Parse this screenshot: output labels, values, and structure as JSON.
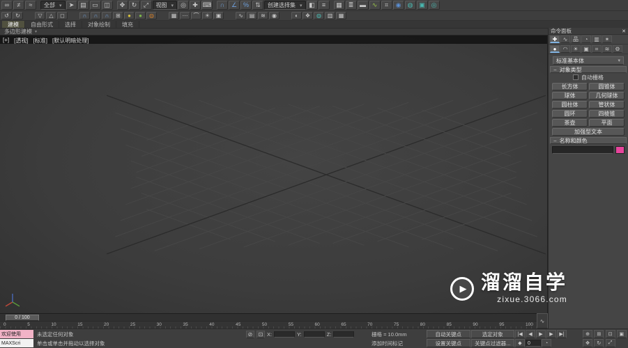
{
  "toolbar1": {
    "items": [
      {
        "name": "select-and-link-icon",
        "glyph": "∞"
      },
      {
        "name": "unlink-selection-icon",
        "glyph": "≠"
      },
      {
        "name": "bind-to-space-warp-icon",
        "glyph": "≈"
      },
      {
        "type": "sep",
        "name": "toolbar-separator",
        "interactable": false
      },
      {
        "type": "dropdown",
        "name": "selection-filter-dropdown",
        "label": "全部"
      },
      {
        "name": "select-object-icon",
        "glyph": "➤"
      },
      {
        "name": "select-by-name-icon",
        "glyph": "▤"
      },
      {
        "name": "rectangular-selection-icon",
        "glyph": "▭"
      },
      {
        "name": "window-crossing-icon",
        "glyph": "◫"
      },
      {
        "type": "sep",
        "name": "toolbar-separator",
        "interactable": false
      },
      {
        "name": "select-and-move-icon",
        "glyph": "✥"
      },
      {
        "name": "select-and-rotate-icon",
        "glyph": "↻"
      },
      {
        "name": "select-and-scale-icon",
        "glyph": "⤢"
      },
      {
        "type": "dropdown",
        "name": "reference-coordinate-dropdown",
        "label": "视图"
      },
      {
        "name": "use-pivot-center-icon",
        "glyph": "◎"
      },
      {
        "name": "select-and-manipulate-icon",
        "glyph": "✚"
      },
      {
        "name": "keyboard-override-icon",
        "glyph": "⌨"
      },
      {
        "type": "sep",
        "name": "toolbar-separator",
        "interactable": false
      },
      {
        "name": "snap-toggle-icon",
        "glyph": "∩",
        "color": "#6fa0dc"
      },
      {
        "name": "angle-snap-icon",
        "glyph": "∠",
        "color": "#6fa0dc"
      },
      {
        "name": "percent-snap-icon",
        "glyph": "%",
        "color": "#6fa0dc"
      },
      {
        "name": "spinner-snap-icon",
        "glyph": "⇅"
      },
      {
        "type": "dropdown",
        "name": "named-selection-sets-dropdown",
        "label": "创建选择集"
      },
      {
        "name": "mirror-icon",
        "glyph": "◧"
      },
      {
        "name": "align-icon",
        "glyph": "≡"
      },
      {
        "type": "sep",
        "name": "toolbar-separator",
        "interactable": false
      },
      {
        "name": "scene-explorer-icon",
        "glyph": "▦"
      },
      {
        "name": "layer-explorer-icon",
        "glyph": "≣"
      },
      {
        "name": "ribbon-toggle-icon",
        "glyph": "▬"
      },
      {
        "name": "curve-editor-icon",
        "glyph": "∿",
        "color": "#9ac54a"
      },
      {
        "name": "schematic-view-icon",
        "glyph": "⌗"
      },
      {
        "name": "material-editor-icon",
        "glyph": "◉",
        "color": "#5b8fd4"
      },
      {
        "name": "render-setup-icon",
        "glyph": "◍",
        "color": "#49b8b0"
      },
      {
        "name": "rendered-frame-icon",
        "glyph": "▣",
        "color": "#49b8b0"
      },
      {
        "name": "render-production-icon",
        "glyph": "◎",
        "color": "#49b8b0"
      }
    ]
  },
  "toolbar2": {
    "items": [
      {
        "name": "undo-icon",
        "glyph": "↺"
      },
      {
        "name": "redo-icon",
        "glyph": "↻"
      },
      {
        "type": "sep",
        "name": "toolbar-separator",
        "interactable": false
      },
      {
        "name": "select-child-icon",
        "glyph": "▽"
      },
      {
        "name": "select-parent-icon",
        "glyph": "△"
      },
      {
        "name": "selection-lock-icon",
        "glyph": "◻"
      },
      {
        "type": "sep",
        "name": "toolbar-separator",
        "interactable": false
      },
      {
        "name": "snap-2d-icon",
        "glyph": "∩",
        "color": "#6fa0dc"
      },
      {
        "name": "snap-25d-icon",
        "glyph": "∩",
        "color": "#6fa0dc"
      },
      {
        "name": "snap-3d-icon",
        "glyph": "∩",
        "color": "#6fa0dc"
      },
      {
        "name": "ortho-toggle-icon",
        "glyph": "⊞"
      },
      {
        "name": "isolate-selection-icon",
        "glyph": "●",
        "color": "#d8c23c"
      },
      {
        "name": "select-similar-icon",
        "glyph": "●",
        "color": "#7db84a"
      },
      {
        "name": "material-sample-icon",
        "glyph": "◍",
        "color": "#c87a2a"
      },
      {
        "type": "sep",
        "name": "toolbar-separator",
        "interactable": false
      },
      {
        "name": "array-icon",
        "glyph": "▦"
      },
      {
        "name": "spacing-tool-icon",
        "glyph": "⋯"
      },
      {
        "name": "measure-icon",
        "glyph": "⌒"
      },
      {
        "name": "light-toggle-icon",
        "glyph": "☀"
      },
      {
        "name": "camera-create-icon",
        "glyph": "▣"
      },
      {
        "type": "sep",
        "name": "toolbar-separator",
        "interactable": false
      },
      {
        "name": "track-view-icon",
        "glyph": "∿"
      },
      {
        "name": "dope-sheet-icon",
        "glyph": "▤"
      },
      {
        "name": "motion-mixer-icon",
        "glyph": "≋"
      },
      {
        "name": "grab-viewport-icon",
        "glyph": "◉"
      },
      {
        "type": "sep",
        "name": "toolbar-separator",
        "interactable": false
      },
      {
        "name": "environment-icon",
        "glyph": "◐"
      },
      {
        "name": "effects-icon",
        "glyph": "❖"
      },
      {
        "name": "render-last-icon",
        "glyph": "◍",
        "color": "#49b8b0"
      },
      {
        "name": "state-sets-icon",
        "glyph": "▥"
      },
      {
        "name": "batch-render-icon",
        "glyph": "▦"
      }
    ]
  },
  "ribbon": {
    "tabs": [
      {
        "label": "建模",
        "active": true
      },
      {
        "label": "自由形式"
      },
      {
        "label": "选择"
      },
      {
        "label": "对象绘制"
      },
      {
        "label": "填充"
      }
    ],
    "minimize_glyph": "▼",
    "panel_label": "多边形建模"
  },
  "viewport": {
    "labels": [
      {
        "name": "viewport-general-menu",
        "label": "[+]"
      },
      {
        "name": "viewport-pov-menu",
        "label": "[透视]"
      },
      {
        "name": "viewport-render-preset-menu",
        "label": "[标准]"
      },
      {
        "name": "viewport-shading-menu",
        "label": "[默认明暗处理]"
      }
    ]
  },
  "command_panel": {
    "title": "命令面板",
    "close_glyph": "✕",
    "collapse_glyph": "−",
    "dropdown_caret": "▾",
    "tabs": [
      {
        "name": "tab-create",
        "glyph": "✚",
        "active": true
      },
      {
        "name": "tab-modify",
        "glyph": "∿"
      },
      {
        "name": "tab-hierarchy",
        "glyph": "品"
      },
      {
        "name": "tab-motion",
        "glyph": "◔"
      },
      {
        "name": "tab-display",
        "glyph": "▥"
      },
      {
        "name": "tab-utilities",
        "glyph": "✶"
      }
    ],
    "subtabs": [
      {
        "name": "subtab-geometry",
        "glyph": "●",
        "active": true
      },
      {
        "name": "subtab-shapes",
        "glyph": "◠"
      },
      {
        "name": "subtab-lights",
        "glyph": "☀"
      },
      {
        "name": "subtab-cameras",
        "glyph": "▣"
      },
      {
        "name": "subtab-helpers",
        "glyph": "⌗"
      },
      {
        "name": "subtab-space-warps",
        "glyph": "≋"
      },
      {
        "name": "subtab-systems",
        "glyph": "⚙"
      }
    ],
    "category": "标准基本体",
    "rollouts": {
      "object_type": "对象类型",
      "name_color": "名称和颜色"
    },
    "autogrid_label": "自动栅格",
    "primitive_buttons": [
      "长方体",
      "圆锥体",
      "球体",
      "几何球体",
      "圆柱体",
      "管状体",
      "圆环",
      "四棱锥",
      "茶壶",
      "平面"
    ],
    "wide_button": "加强型文本",
    "name_value": "",
    "swatch_color": "#e8459c"
  },
  "timeline": {
    "handle_label": "0 / 100",
    "ticks": [
      "0",
      "5",
      "10",
      "15",
      "20",
      "25",
      "30",
      "35",
      "40",
      "45",
      "50",
      "55",
      "60",
      "65",
      "70",
      "75",
      "80",
      "85",
      "90",
      "95",
      "100"
    ],
    "mini_curve_glyph": "∿"
  },
  "status": {
    "macro_row": "欢迎使用",
    "listener_row": "MAXScri",
    "status_line": "未选定任何对象",
    "prompt_line": "单击或单击并拖动以选择对象",
    "isolate_glyph": "⊘",
    "lock_glyph": "⊡",
    "x_label": "X:",
    "y_label": "Y:",
    "z_label": "Z:",
    "grid_label": "栅格 = 10.0mm",
    "time_tag": "添加时间标记",
    "auto_key": "自动关键点",
    "selected": "选定对象",
    "set_key": "设置关键点",
    "key_filters": "关键点过滤器...",
    "frame_field": "0",
    "key_toggle_glyph": "◆",
    "time_config_glyph": "◔",
    "playback": [
      {
        "name": "go-to-start-button",
        "glyph": "|◀"
      },
      {
        "name": "previous-frame-button",
        "glyph": "◀"
      },
      {
        "name": "play-button",
        "glyph": "▶"
      },
      {
        "name": "next-frame-button",
        "glyph": "▶"
      },
      {
        "name": "go-to-end-button",
        "glyph": "▶|"
      }
    ],
    "nav": [
      {
        "name": "zoom-button",
        "glyph": "⊕"
      },
      {
        "name": "zoom-all-button",
        "glyph": "⊞"
      },
      {
        "name": "zoom-extents-button",
        "glyph": "⊡"
      },
      {
        "name": "zoom-region-button",
        "glyph": "▣"
      },
      {
        "name": "pan-button",
        "glyph": "✥"
      },
      {
        "name": "orbit-button",
        "glyph": "↻"
      },
      {
        "name": "maximize-button",
        "glyph": "⤢"
      }
    ]
  },
  "watermark": {
    "play_glyph": "▶",
    "title": "溜溜自学",
    "url": "zixue.3066.com"
  }
}
